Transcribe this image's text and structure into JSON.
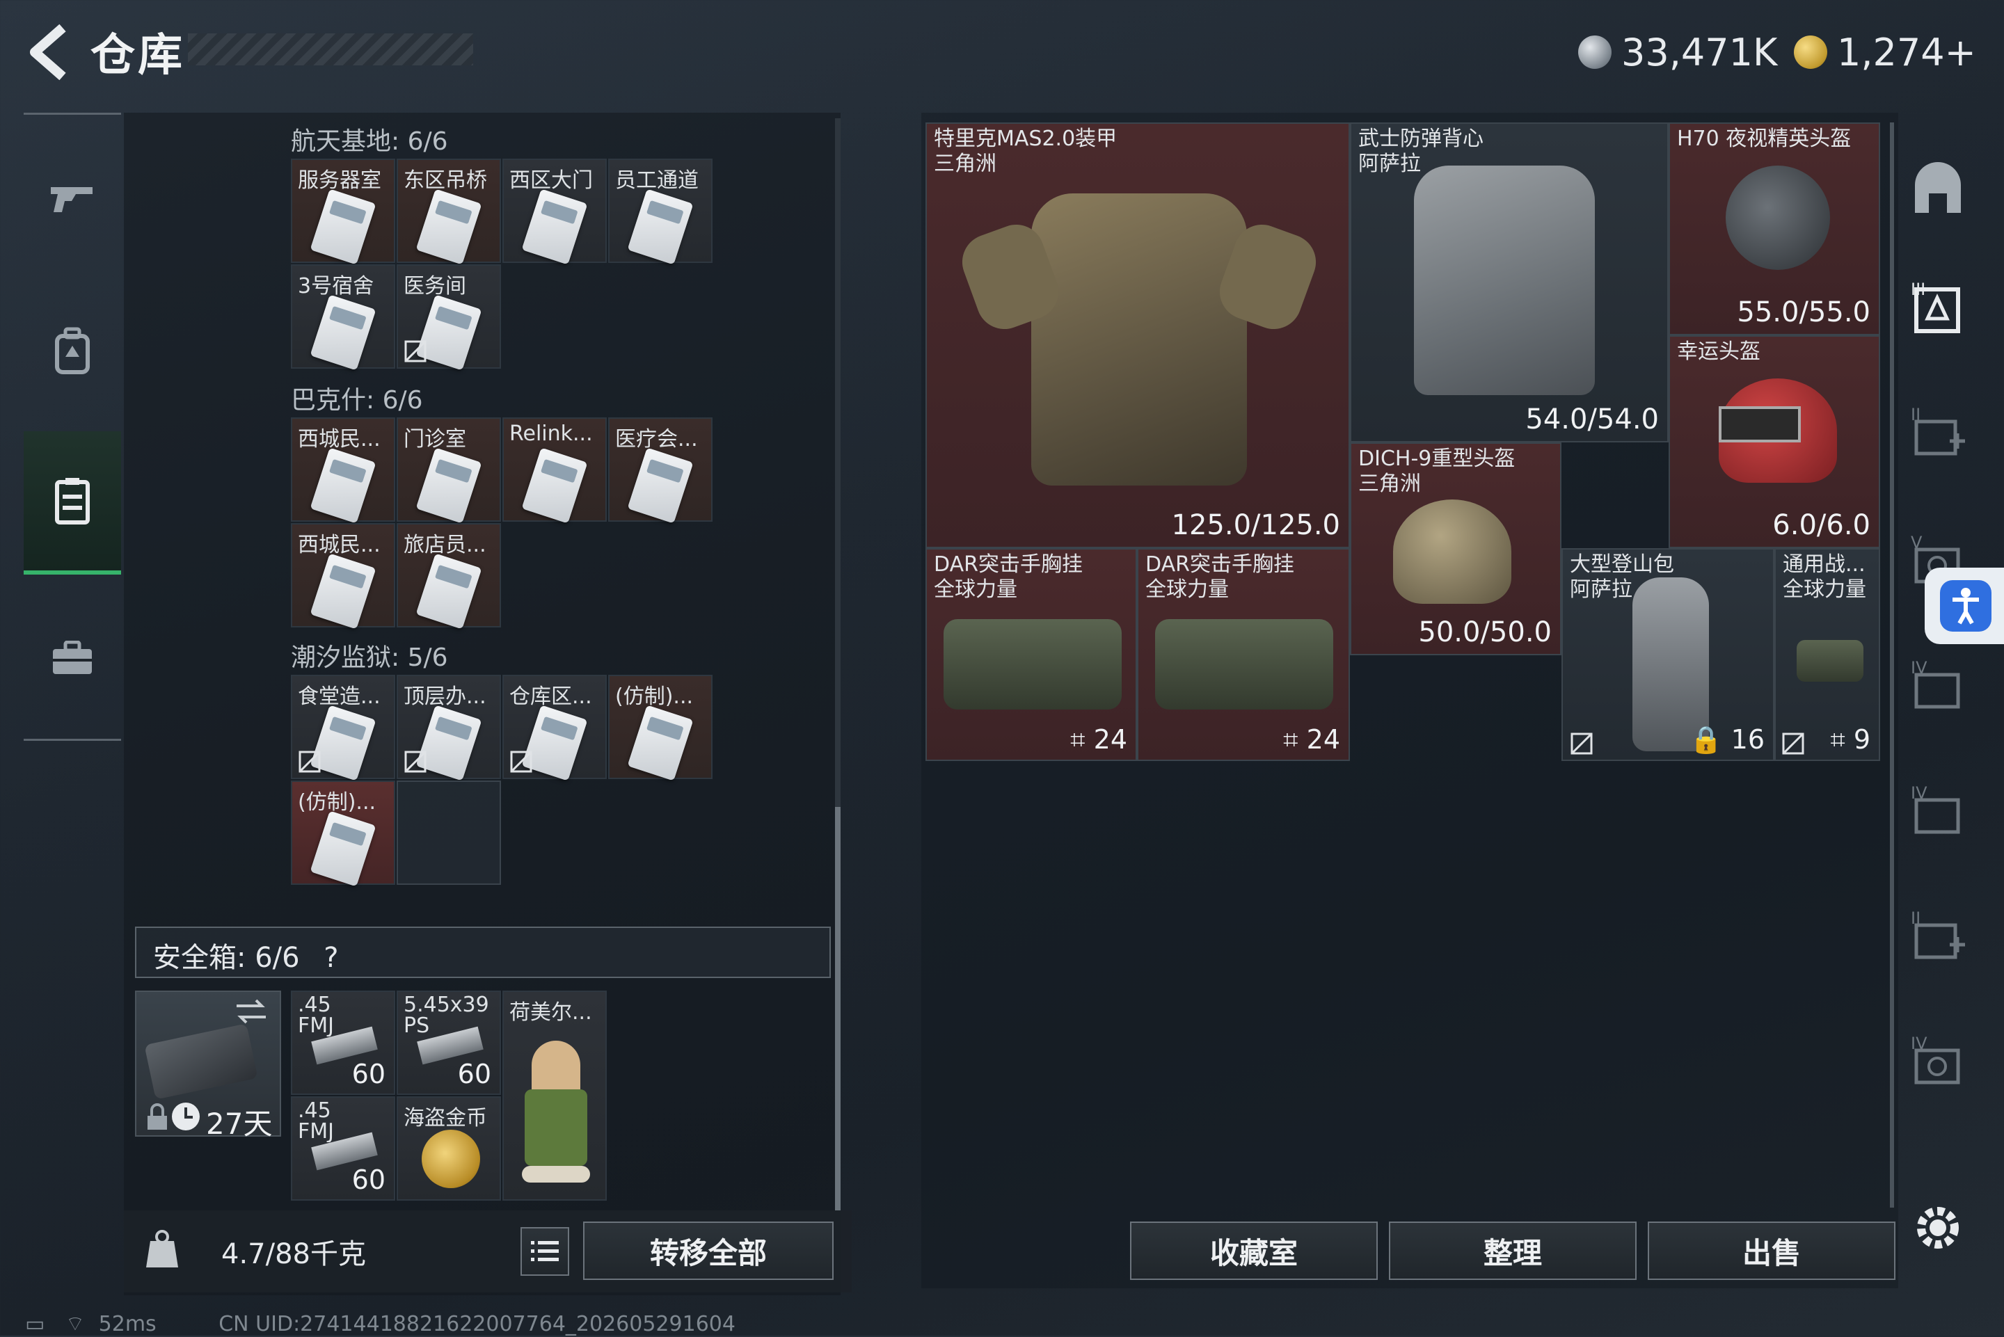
{
  "header": {
    "title": "仓库",
    "currency_silver": "33,471K",
    "currency_gold": "1,274+"
  },
  "sections": [
    {
      "title": "航天基地: 6/6",
      "cells": [
        "服务器室",
        "东区吊桥",
        "西区大门",
        "员工通道",
        "3号宿舍",
        "医务间"
      ]
    },
    {
      "title": "巴克什: 6/6",
      "cells": [
        "西城民...",
        "门诊室",
        "Relink...",
        "医疗会...",
        "西城民...",
        "旅店员..."
      ]
    },
    {
      "title": "潮汐监狱: 5/6",
      "cells": [
        "食堂造...",
        "顶层办...",
        "仓库区...",
        "(仿制)...",
        "(仿制)..."
      ]
    }
  ],
  "safe_box": {
    "title": "安全箱: 6/6",
    "help": "?",
    "timer": "27天",
    "items": [
      {
        "name": ".45 FMJ",
        "count": "60"
      },
      {
        "name": "5.45x39 PS",
        "count": "60"
      },
      {
        "name": "荷美尔...",
        "count": ""
      },
      {
        "name": ".45 FMJ",
        "count": "60"
      },
      {
        "name": "海盗金币",
        "count": ""
      }
    ]
  },
  "weight": "4.7/88千克",
  "buttons": {
    "transfer_all": "转移全部",
    "collection": "收藏室",
    "organize": "整理",
    "sell": "出售"
  },
  "storage_items": [
    {
      "name": "特里克MAS2.0装甲",
      "sub": "三角洲",
      "value": "125.0/125.0"
    },
    {
      "name": "武士防弹背心",
      "sub": "阿萨拉",
      "value": "54.0/54.0"
    },
    {
      "name": "H70 夜视精英头盔",
      "sub": "",
      "value": "55.0/55.0"
    },
    {
      "name": "幸运头盔",
      "sub": "",
      "value": "6.0/6.0"
    },
    {
      "name": "DICH-9重型头盔",
      "sub": "三角洲",
      "value": "50.0/50.0"
    },
    {
      "name": "DAR突击手胸挂",
      "sub": "全球力量",
      "value": "24"
    },
    {
      "name": "DAR突击手胸挂",
      "sub": "全球力量",
      "value": "24"
    },
    {
      "name": "大型登山包",
      "sub": "阿萨拉",
      "value": "16"
    },
    {
      "name": "通用战...",
      "sub": "全球力量",
      "value": "9"
    }
  ],
  "status": {
    "ping": "52ms",
    "uid": "CN UID:2741441882162200776​4_202605291604"
  },
  "colors": {
    "accent_green": "#36b36a",
    "item_red_bg": "#4a2a2c",
    "accessibility_blue": "#2f6fe0"
  }
}
